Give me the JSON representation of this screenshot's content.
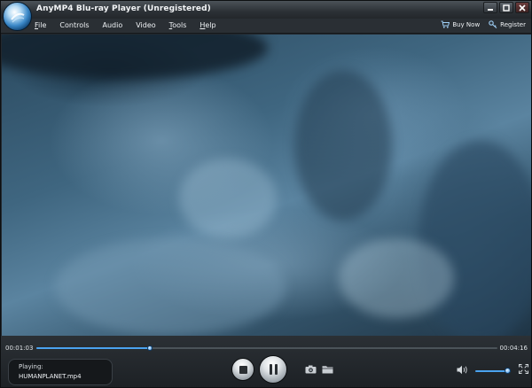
{
  "app": {
    "title": "AnyMP4 Blu-ray Player (Unregistered)"
  },
  "menu": {
    "items": [
      {
        "key": "F",
        "rest": "ile"
      },
      {
        "key": "",
        "rest": "Controls"
      },
      {
        "key": "",
        "rest": "Audio"
      },
      {
        "key": "",
        "rest": "Video"
      },
      {
        "key": "T",
        "rest": "ools"
      },
      {
        "key": "H",
        "rest": "elp"
      }
    ],
    "buy_now": "Buy Now",
    "register": "Register"
  },
  "player": {
    "current_time": "00:01:03",
    "total_time": "00:04:16",
    "progress_fraction": 0.246,
    "volume_fraction": 0.9,
    "status_label": "Playing:",
    "file_name": "HUMANPLANET.mp4"
  },
  "icons": {
    "logo": "anymp4-logo-icon",
    "buy_now": "cart-icon",
    "register": "key-icon",
    "stop": "stop-icon",
    "pause": "pause-icon",
    "snapshot": "camera-icon",
    "open": "folder-icon",
    "volume": "speaker-icon",
    "fullscreen": "fullscreen-icon"
  },
  "colors": {
    "accent": "#4aa3ef",
    "window_bg": "#23282d"
  }
}
